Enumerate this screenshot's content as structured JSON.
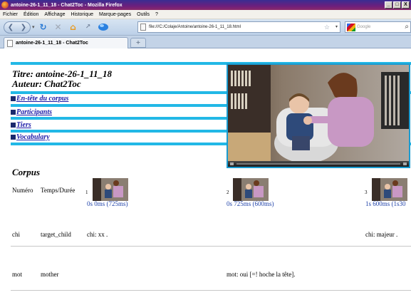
{
  "window": {
    "title": "antoine-26-1_11_18 - Chat2Toc - Mozilla Firefox",
    "buttons": [
      "_",
      "□",
      "X"
    ]
  },
  "menu": [
    "Fichier",
    "Édition",
    "Affichage",
    "Historique",
    "Marque-pages",
    "Outils",
    "?"
  ],
  "navbar": {
    "url": "file:///C:/Colaje/Antoine/antoine-26-1_11_18.html",
    "search_placeholder": "Google"
  },
  "tab": {
    "label": "antoine-26-1_11_18 - Chat2Toc",
    "new_tab": "+"
  },
  "page": {
    "title": "Titre: antoine-26-1_11_18",
    "author": "Auteur: Chat2Toc",
    "links": [
      "En-tête du corpus",
      "Participants",
      "Tiers",
      "Vocabulary"
    ],
    "corpus_heading": "Corpus",
    "table": {
      "col_numero": "Numéro",
      "col_temps": "Temps/Durée",
      "segments": [
        {
          "num": "1",
          "time": "0s 0ms (725ms)"
        },
        {
          "num": "2",
          "time": "0s 725ms (600ms)"
        },
        {
          "num": "3",
          "time": "1s 600ms (1s30"
        }
      ],
      "rows": [
        {
          "speaker": "chi",
          "role": "target_child",
          "utt1": "chi: xx .",
          "utt2": "",
          "utt3": "chi: majeur ."
        },
        {
          "speaker": "mot",
          "role": "mother",
          "utt1": "",
          "utt2": "mot: oui [=! hoche la tête].",
          "utt3": ""
        }
      ]
    }
  },
  "colors": {
    "accent_bar": "#22b8e6",
    "link": "#1a1aa8",
    "time_text": "#2244aa"
  }
}
